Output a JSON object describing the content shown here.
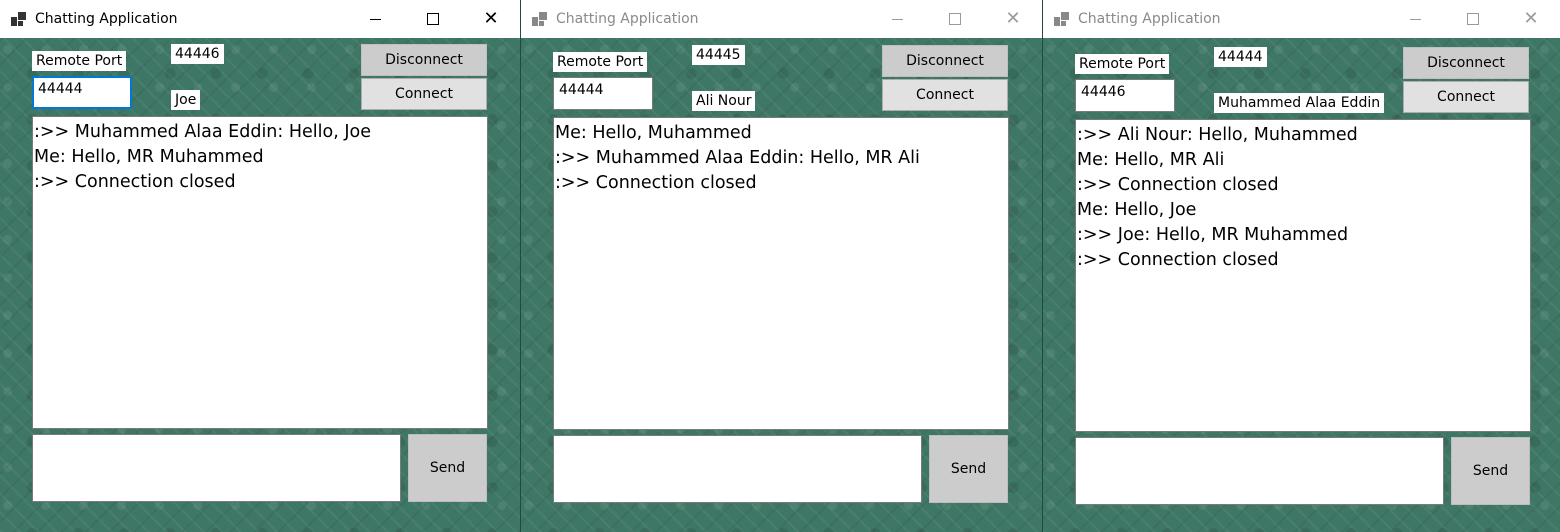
{
  "windows": [
    {
      "title": "Chatting Application",
      "local_port": "44446",
      "remote_port_label": "Remote Port",
      "remote_port_value": "44444",
      "user_name": "Joe",
      "disconnect_label": "Disconnect",
      "connect_label": "Connect",
      "send_label": "Send",
      "messages": [
        ":>> Muhammed Alaa Eddin: Hello, Joe",
        "Me: Hello, MR Muhammed",
        ":>> Connection closed"
      ]
    },
    {
      "title": "Chatting Application",
      "local_port": "44445",
      "remote_port_label": "Remote Port",
      "remote_port_value": "44444",
      "user_name": "Ali Nour",
      "disconnect_label": "Disconnect",
      "connect_label": "Connect",
      "send_label": "Send",
      "messages": [
        "Me: Hello, Muhammed",
        ":>> Muhammed Alaa Eddin: Hello, MR Ali",
        ":>> Connection closed"
      ]
    },
    {
      "title": "Chatting Application",
      "local_port": "44444",
      "remote_port_label": "Remote Port",
      "remote_port_value": "44446",
      "user_name": "Muhammed Alaa Eddin",
      "disconnect_label": "Disconnect",
      "connect_label": "Connect",
      "send_label": "Send",
      "messages": [
        ":>> Ali Nour: Hello, Muhammed",
        "Me: Hello, MR Ali",
        ":>> Connection closed",
        "Me: Hello, Joe",
        ":>> Joe: Hello, MR Muhammed",
        ":>> Connection closed"
      ]
    }
  ],
  "icons": {
    "app": "app-windows-icon",
    "minimize": "minimize-icon",
    "maximize": "maximize-icon",
    "close": "close-icon"
  }
}
